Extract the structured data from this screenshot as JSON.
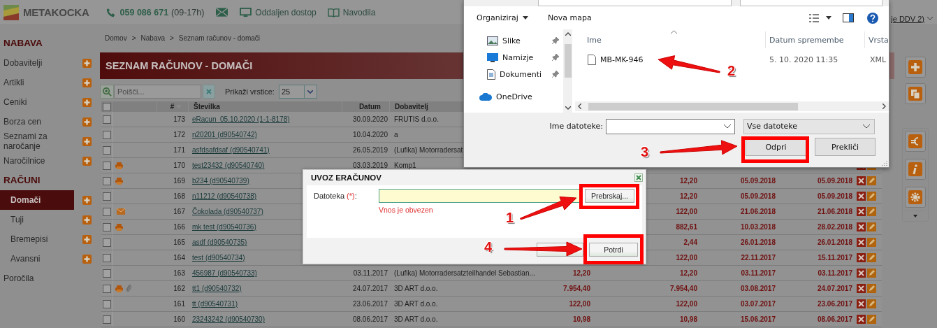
{
  "header": {
    "logo": "METAKOCKA",
    "phone": "059 086 671",
    "hours": "(09-17h)",
    "links": [
      {
        "kind": "remote",
        "label": "Oddaljen dostop"
      },
      {
        "kind": "manual",
        "label": "Navodila"
      }
    ],
    "account_text": "je DDV 2)"
  },
  "sidebar": [
    {
      "kind": "section",
      "title": "NABAVA",
      "indented": false,
      "items": [
        {
          "label": "Dobavitelji",
          "selected": false
        },
        {
          "label": "Artikli",
          "selected": false
        },
        {
          "label": "Ceniki",
          "selected": false
        },
        {
          "label": "Borza cen",
          "selected": false
        },
        {
          "label": "Seznami za naročanje",
          "selected": false
        },
        {
          "label": "Naročilnice",
          "selected": false
        }
      ]
    },
    {
      "kind": "section",
      "title": "RAČUNI",
      "indented": true,
      "items": [
        {
          "label": "Domači",
          "selected": true
        },
        {
          "label": "Tuji",
          "selected": false
        },
        {
          "label": "Bremepisi",
          "selected": false
        },
        {
          "label": "Avansni",
          "selected": false
        }
      ]
    },
    {
      "kind": "link",
      "title": "Poročila"
    }
  ],
  "breadcrumb": {
    "items": [
      "Domov",
      "Nabava",
      "Seznam računov - domači"
    ],
    "separator": ">"
  },
  "page_title": "SEZNAM RAČUNOV - DOMAČI",
  "toolbar": {
    "search": {
      "placeholder": "Poišči..."
    },
    "rows_label": "Prikaži vrstice:",
    "rows_value": "25"
  },
  "table": {
    "select_all_checked": false,
    "columns": [
      {
        "label": "#",
        "sorted": true
      },
      {
        "label": "Številka",
        "sorted": false
      },
      {
        "label": "Datum",
        "sorted": false
      },
      {
        "label": "Dobavitelj",
        "sorted": false
      }
    ],
    "rows": [
      {
        "checked": false,
        "icons": [],
        "number": "173",
        "document": "eRacun_05.10.2020 (1-1-8178)",
        "date": "30.09.2020",
        "supplier": "FRUTIS d.o.o.",
        "actions": []
      },
      {
        "checked": false,
        "icons": [],
        "number": "172",
        "document": "n20201 (d90540742)",
        "date": "10.04.2020",
        "supplier": "a",
        "actions": []
      },
      {
        "checked": false,
        "icons": [],
        "number": "171",
        "document": "asfdsafdsaf (d90540741)",
        "date": "26.05.2019",
        "supplier": "(Lufika) Motorradersat",
        "actions": []
      },
      {
        "checked": false,
        "icons": [
          {
            "kind": "print"
          }
        ],
        "number": "170",
        "document": "test23432 (d90540740)",
        "date": "03.03.2019",
        "supplier": "Komp1",
        "actions": [
          {
            "kind": "delete"
          },
          {
            "kind": "edit"
          }
        ]
      },
      {
        "checked": false,
        "icons": [
          {
            "kind": "print"
          }
        ],
        "number": "169",
        "document": "b234 (d90540739)",
        "column_8": "12,20",
        "column_9": "05.09.2018",
        "column_10": "05.09.2018",
        "actions": [
          {
            "kind": "delete"
          },
          {
            "kind": "edit"
          }
        ]
      },
      {
        "checked": false,
        "icons": [],
        "number": "168",
        "document": "n11212 (d90540738)",
        "column_8": "12,20",
        "column_9": "05.09.2018",
        "column_10": "05.09.2018",
        "actions": [
          {
            "kind": "delete"
          },
          {
            "kind": "edit"
          }
        ]
      },
      {
        "checked": false,
        "icons": [
          {
            "kind": "mail"
          }
        ],
        "number": "167",
        "document": "Čokolada (d90540737)",
        "column_8": "122,00",
        "column_9": "21.06.2018",
        "column_10": "21.06.2018",
        "actions": [
          {
            "kind": "delete"
          },
          {
            "kind": "edit"
          }
        ]
      },
      {
        "checked": false,
        "icons": [
          {
            "kind": "print"
          }
        ],
        "number": "166",
        "document": "mk test (d90540736)",
        "column_8": "882,61",
        "column_9": "10.03.2018",
        "column_10": "28.02.2018",
        "actions": [
          {
            "kind": "delete"
          },
          {
            "kind": "edit"
          }
        ]
      },
      {
        "checked": false,
        "icons": [],
        "number": "165",
        "document": "asdf (d90540735)",
        "column_8": "2,44",
        "column_9": "26.01.2018",
        "column_10": "26.01.2018",
        "actions": [
          {
            "kind": "delete"
          },
          {
            "kind": "edit"
          }
        ]
      },
      {
        "checked": false,
        "icons": [],
        "number": "164",
        "document": "test (d90540734)",
        "column_8": "122,00",
        "column_9": "22.11.2017",
        "column_10": "15.11.2017",
        "actions": [
          {
            "kind": "delete"
          },
          {
            "kind": "edit"
          }
        ]
      },
      {
        "checked": false,
        "icons": [],
        "number": "163",
        "document": "456987 (d90540733)",
        "date": "03.11.2017",
        "supplier": "(Lufika) Motorradersatzteilhandel Sebastian...",
        "column_7": "12,20",
        "column_8": "12,20",
        "column_9": "03.11.2017",
        "column_10": "03.11.2017",
        "actions": [
          {
            "kind": "delete"
          },
          {
            "kind": "edit"
          }
        ]
      },
      {
        "checked": false,
        "icons": [
          {
            "kind": "print"
          },
          {
            "kind": "attachment"
          }
        ],
        "number": "162",
        "document": "tt1 (d90540732)",
        "date": "24.07.2017",
        "supplier": "3D ART d.o.o.",
        "column_7": "7.954,40",
        "column_8": "7.954,40",
        "column_9": "03.08.2017",
        "column_10": "24.07.2017",
        "actions": [
          {
            "kind": "delete"
          },
          {
            "kind": "edit"
          }
        ]
      },
      {
        "checked": false,
        "icons": [],
        "number": "161",
        "document": "tt (d90540731)",
        "date": "23.06.2017",
        "supplier": "3D ART d.o.o.",
        "column_7": "122,00",
        "column_8": "122,00",
        "column_9": "03.07.2017",
        "column_10": "23.06.2017",
        "actions": [
          {
            "kind": "delete"
          },
          {
            "kind": "edit"
          }
        ]
      },
      {
        "checked": false,
        "icons": [],
        "number": "160",
        "document": "23243242 (d90540730)",
        "date": "08.06.2017",
        "supplier": "3D ART d.o.o.",
        "column_7": "10,98",
        "column_8": "10,98",
        "column_9": "15.06.2017",
        "column_10": "08.06.2017",
        "actions": [
          {
            "kind": "delete"
          },
          {
            "kind": "edit"
          }
        ]
      }
    ]
  },
  "file_dialog": {
    "toolbar": [
      "Organiziraj",
      "Nova mapa"
    ],
    "nav_items": [
      {
        "kind": "pictures",
        "label": "Slike",
        "pinned": true
      },
      {
        "kind": "desktop",
        "label": "Namizje",
        "pinned": true
      },
      {
        "kind": "documents",
        "label": "Dokumenti",
        "pinned": true
      },
      {
        "kind": "cloud",
        "label": "OneDrive",
        "pinned": false
      }
    ],
    "columns": [
      "Ime",
      "Datum spremembe",
      "Vrsta"
    ],
    "files": [
      {
        "name": "MB-MK-946",
        "modified": "5. 10. 2020 11:35",
        "type": "XML",
        "selected": false
      }
    ],
    "filename_label": "Ime datoteke:",
    "filter": "Vse datoteke",
    "open_button": "Odpri",
    "cancel_button": "Prekliči"
  },
  "import_dialog": {
    "title": "UVOZ ERAČUNOV",
    "field_label": "Datoteka",
    "required_mark": "(*)",
    "label_suffix": ":",
    "error": "Vnos je obvezen",
    "browse_button": "Prebrskaj...",
    "confirm_button": "Potrdi"
  },
  "annotations": [
    {
      "number": "1"
    },
    {
      "number": "2"
    },
    {
      "number": "3"
    },
    {
      "number": "4"
    }
  ]
}
